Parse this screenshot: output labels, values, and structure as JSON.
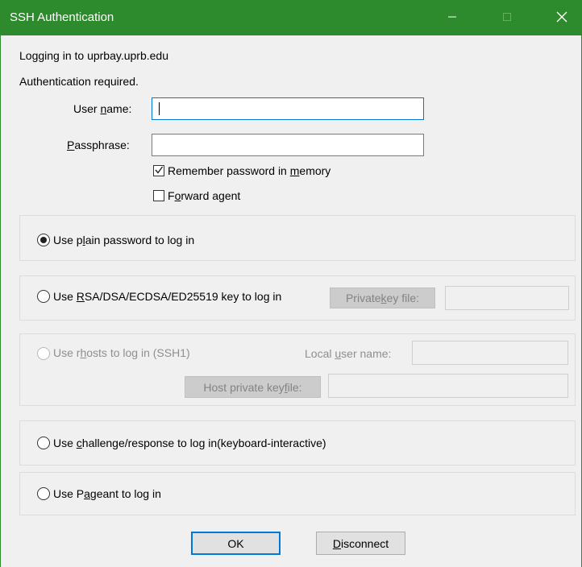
{
  "window": {
    "title": "SSH Authentication",
    "minimize_icon": "minimize-icon",
    "maximize_icon": "maximize-icon",
    "close_icon": "close-icon",
    "accent_color": "#2d8b2d"
  },
  "info": {
    "login_line": "Logging in to uprbay.uprb.edu",
    "status_line": "Authentication required."
  },
  "form": {
    "username_label": "User name:",
    "username_value": "",
    "passphrase_label": "Passphrase:",
    "passphrase_value": "",
    "remember_label": "Remember password in memory",
    "remember_checked": true,
    "forward_label": "Forward agent",
    "forward_checked": false
  },
  "methods": {
    "plain": {
      "label": "Use plain password to log in",
      "selected": true
    },
    "rsa": {
      "label": "Use RSA/DSA/ECDSA/ED25519 key to log in",
      "selected": false,
      "key_button": "Private key file:",
      "key_value": ""
    },
    "rhosts": {
      "label": "Use rhosts to log in (SSH1)",
      "selected": false,
      "local_user_label": "Local user name:",
      "local_user_value": "",
      "host_key_button": "Host private key file:",
      "host_key_value": ""
    },
    "challenge": {
      "label": "Use challenge/response to log in(keyboard-interactive)",
      "selected": false
    },
    "pageant": {
      "label": "Use Pageant to log in",
      "selected": false
    }
  },
  "buttons": {
    "ok": "OK",
    "disconnect": "Disconnect"
  }
}
